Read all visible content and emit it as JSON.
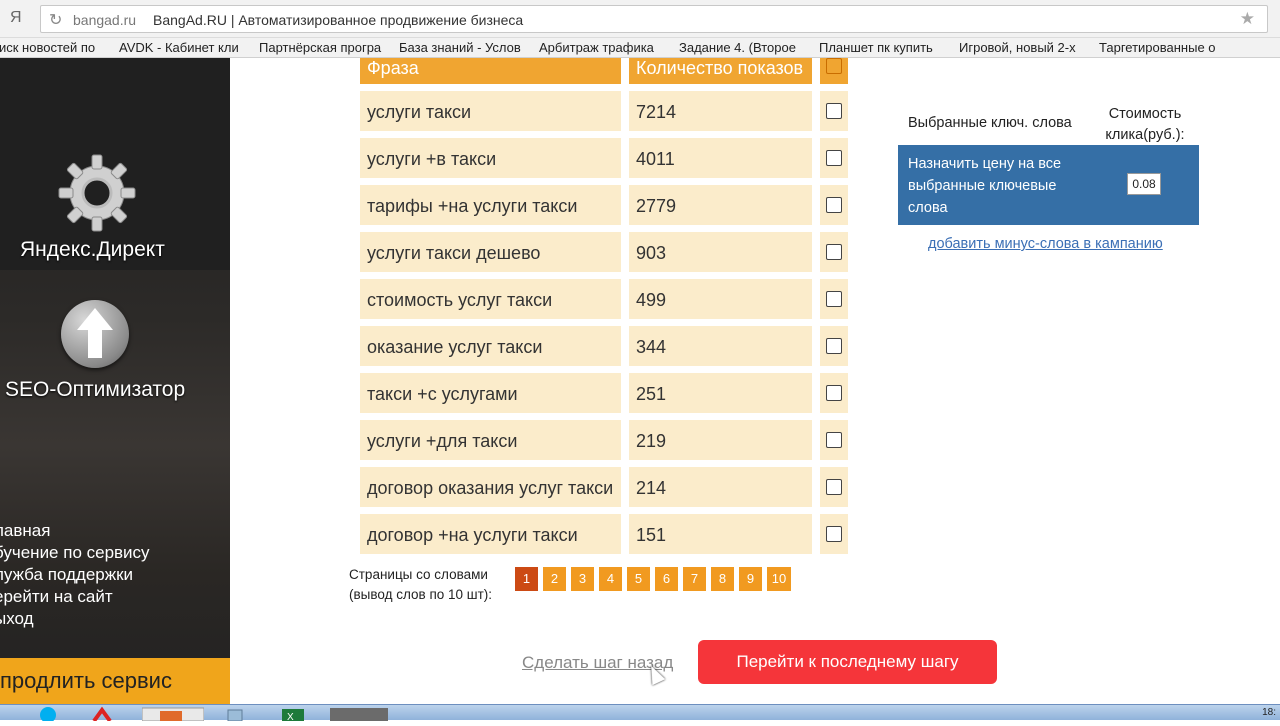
{
  "browser": {
    "logo": "Я",
    "url_domain": "bangad.ru",
    "page_title": "BangAd.RU | Автоматизированное продвижение бизнеса",
    "bookmarks": [
      "иск новостей по",
      "AVDK - Кабинет кли",
      "Партнёрская програ",
      "База знаний - Услов",
      "Арбитраж трафика",
      "Задание 4. (Второе",
      "Планшет пк купить",
      "Игровой, новый 2-х",
      "Таргетированные о"
    ]
  },
  "sidebar": {
    "yandex_label": "Яндекс.Директ",
    "seo_label": "SEO-Оптимизатор",
    "menu": [
      "лавная",
      "бучение по сервису",
      "лужба поддержки",
      "ерейти на сайт",
      "ыход"
    ],
    "prolong_label": "продлить сервис"
  },
  "table": {
    "header": {
      "phrase": "Фраза",
      "count": "Количество показов"
    },
    "rows": [
      {
        "phrase": "услуги такси",
        "count": "7214"
      },
      {
        "phrase": "услуги +в такси",
        "count": "4011"
      },
      {
        "phrase": "тарифы +на услуги такси",
        "count": "2779"
      },
      {
        "phrase": "услуги такси дешево",
        "count": "903"
      },
      {
        "phrase": "стоимость услуг такси",
        "count": "499"
      },
      {
        "phrase": "оказание услуг такси",
        "count": "344"
      },
      {
        "phrase": "такси +с услугами",
        "count": "251"
      },
      {
        "phrase": "услуги +для такси",
        "count": "219"
      },
      {
        "phrase": "договор оказания услуг такси",
        "count": "214"
      },
      {
        "phrase": "договор +на услуги такси",
        "count": "151"
      }
    ]
  },
  "pagination": {
    "label_line1": "Страницы со словами",
    "label_line2": "(вывод слов по 10 шт):",
    "pages": [
      "1",
      "2",
      "3",
      "4",
      "5",
      "6",
      "7",
      "8",
      "9",
      "10"
    ],
    "active": "1"
  },
  "right_panel": {
    "selected_label": "Выбранные ключ. слова",
    "cost_label_line1": "Стоимость",
    "cost_label_line2": "клика(руб.):",
    "assign_price_text": "Назначить цену на все выбранные ключевые слова",
    "price_value": "0.08",
    "minus_words_link": "добавить минус-слова в кампанию"
  },
  "actions": {
    "back_label": "Сделать шаг назад",
    "next_label": "Перейти к последнему шагу"
  },
  "taskbar": {
    "time": "18:"
  },
  "colors": {
    "header_orange": "#f0a531",
    "row_cream": "#fbeccb",
    "page_orange": "#f19a20",
    "page_active": "#cc4a14",
    "blue_panel": "#356fa6",
    "next_button_red": "#f5353a",
    "prolong_yellow": "#f0a51b"
  }
}
